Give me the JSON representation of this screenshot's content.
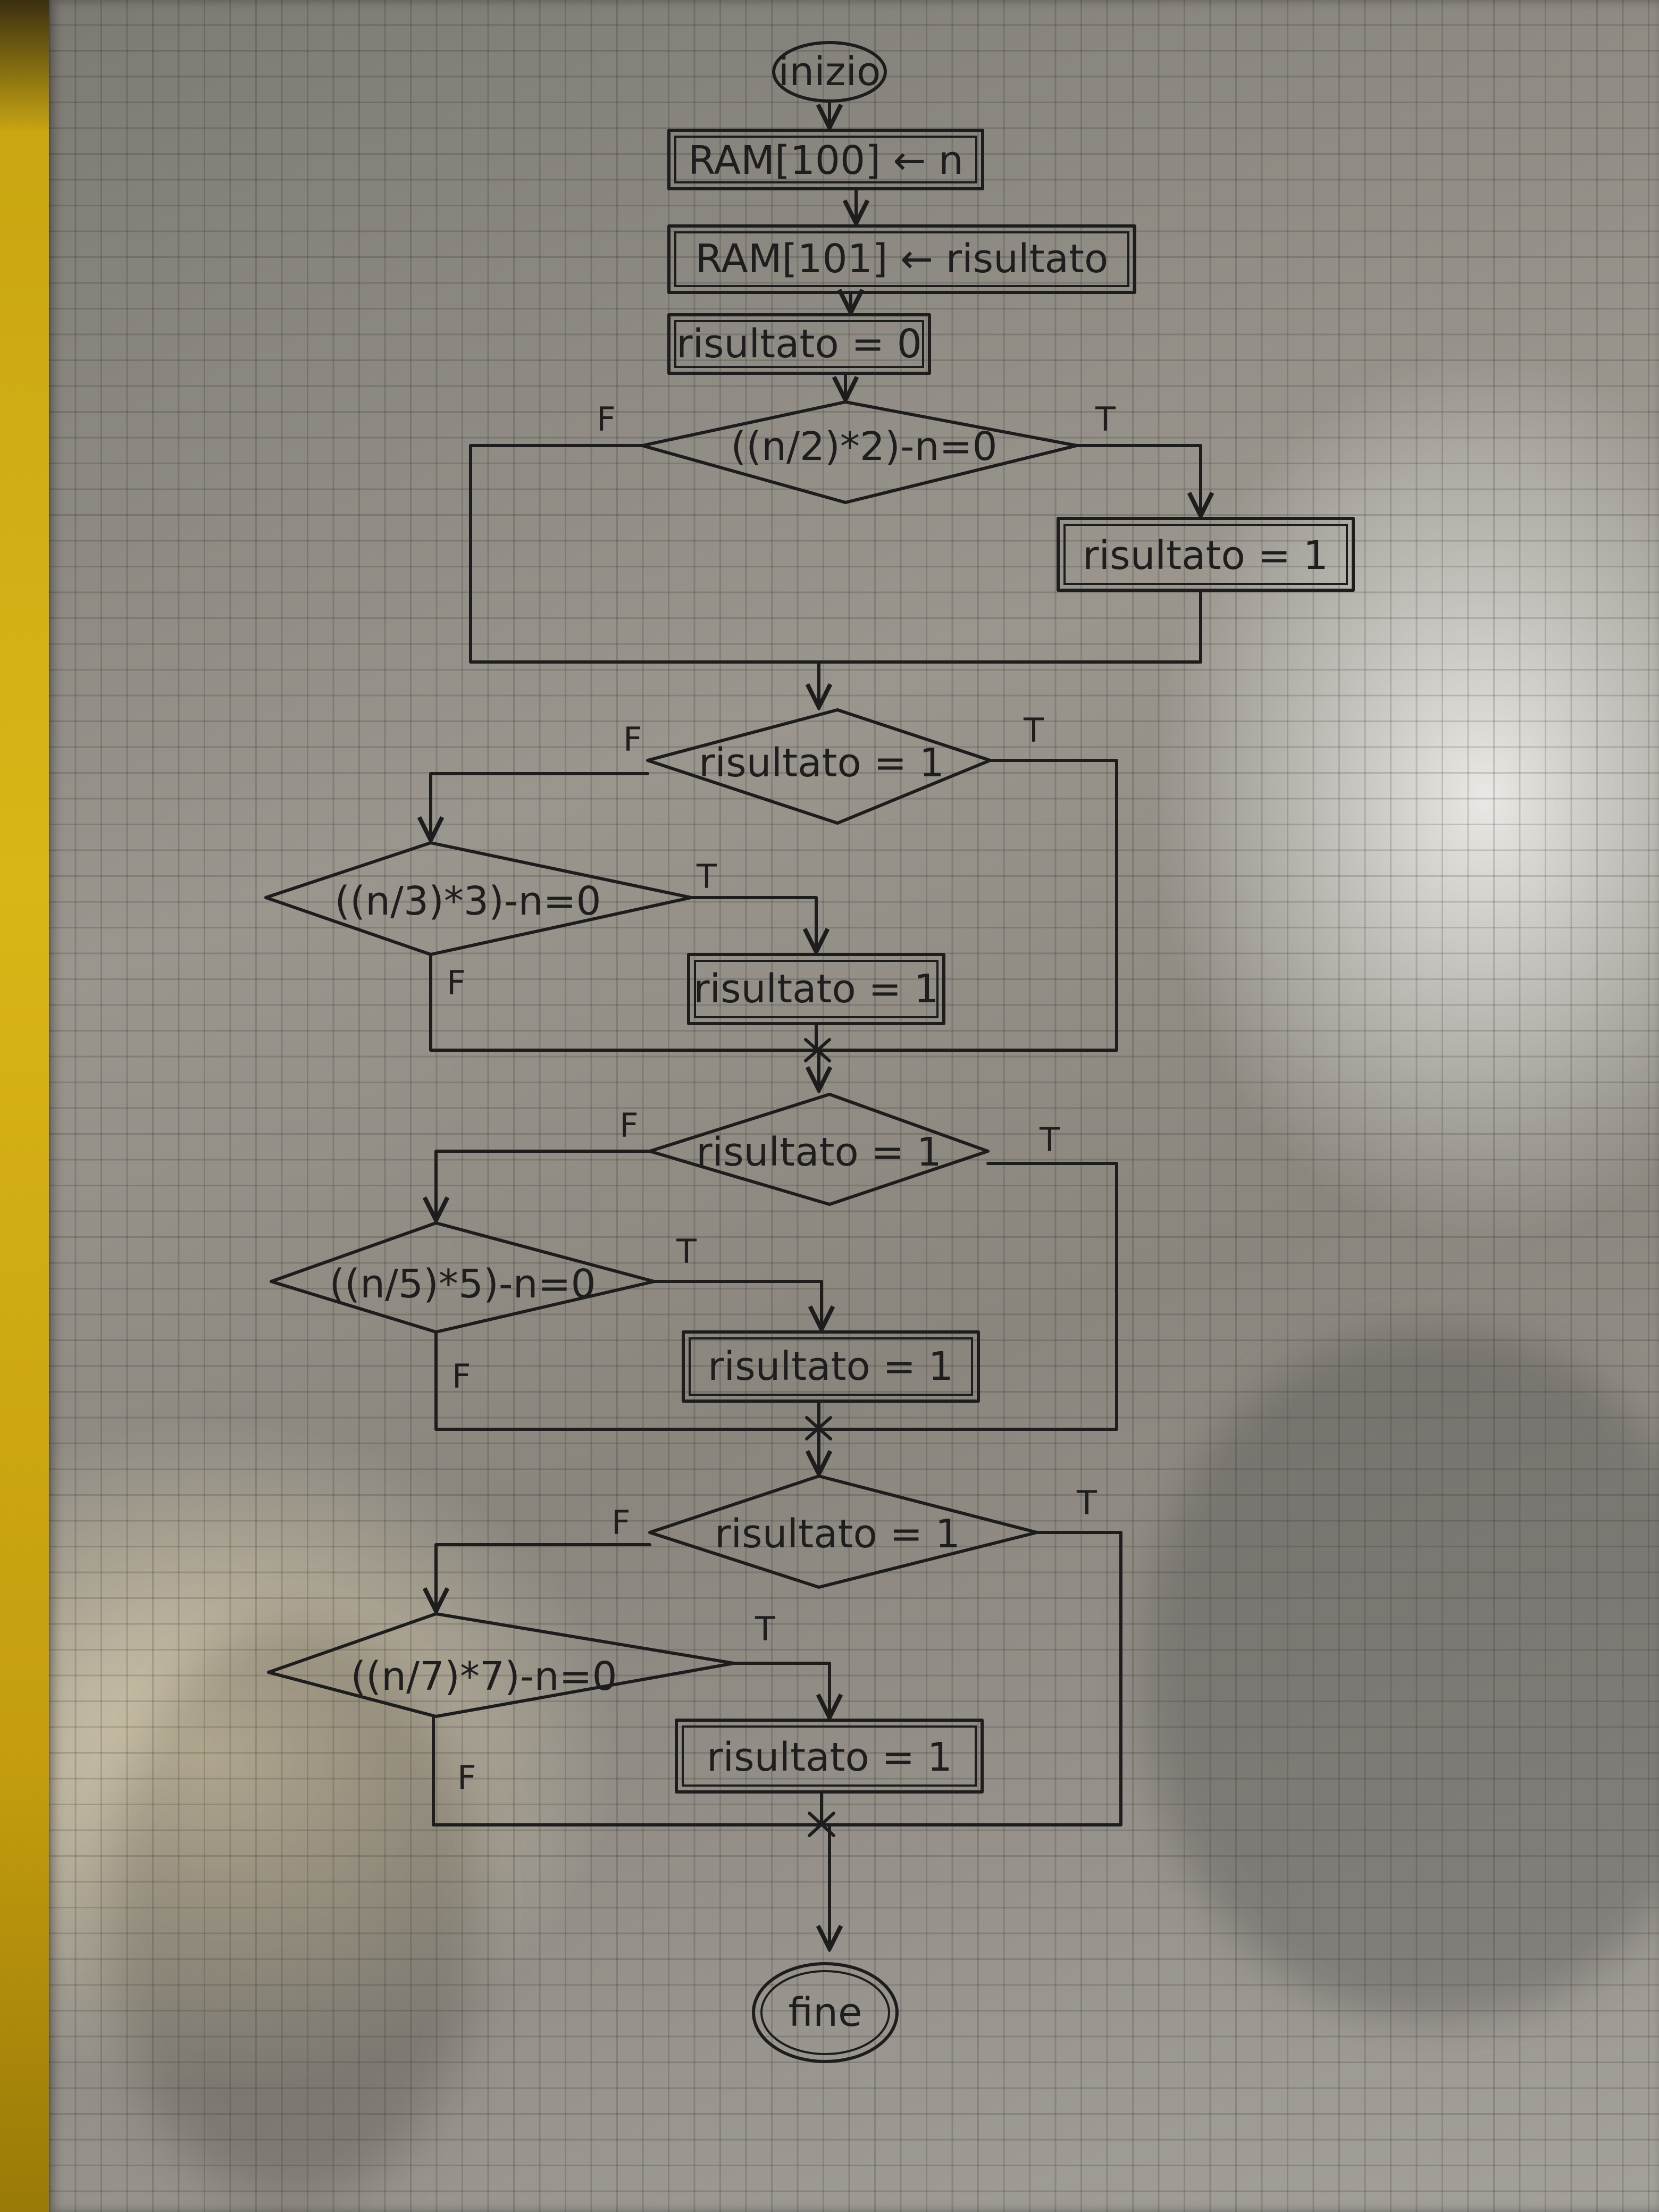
{
  "flowchart": {
    "start": {
      "label": "inizio"
    },
    "init": [
      {
        "label": "RAM[100] ← n"
      },
      {
        "label": "RAM[101] ← risultato"
      },
      {
        "label": "risultato = 0"
      }
    ],
    "stage_1": {
      "test": {
        "label": "((n/2)*2)-n=0"
      },
      "assign": {
        "label": "risultato = 1"
      }
    },
    "stage_2": {
      "check": {
        "label": "risultato = 1"
      },
      "test": {
        "label": "((n/3)*3)-n=0"
      },
      "assign": {
        "label": "risultato = 1"
      }
    },
    "stage_3": {
      "check": {
        "label": "risultato = 1"
      },
      "test": {
        "label": "((n/5)*5)-n=0"
      },
      "assign": {
        "label": "risultato = 1"
      }
    },
    "stage_4": {
      "check": {
        "label": "risultato = 1"
      },
      "test": {
        "label": "((n/7)*7)-n=0"
      },
      "assign": {
        "label": "risultato = 1"
      }
    },
    "end": {
      "label": "fine"
    },
    "branch_labels": {
      "true": "T",
      "false": "F"
    }
  }
}
